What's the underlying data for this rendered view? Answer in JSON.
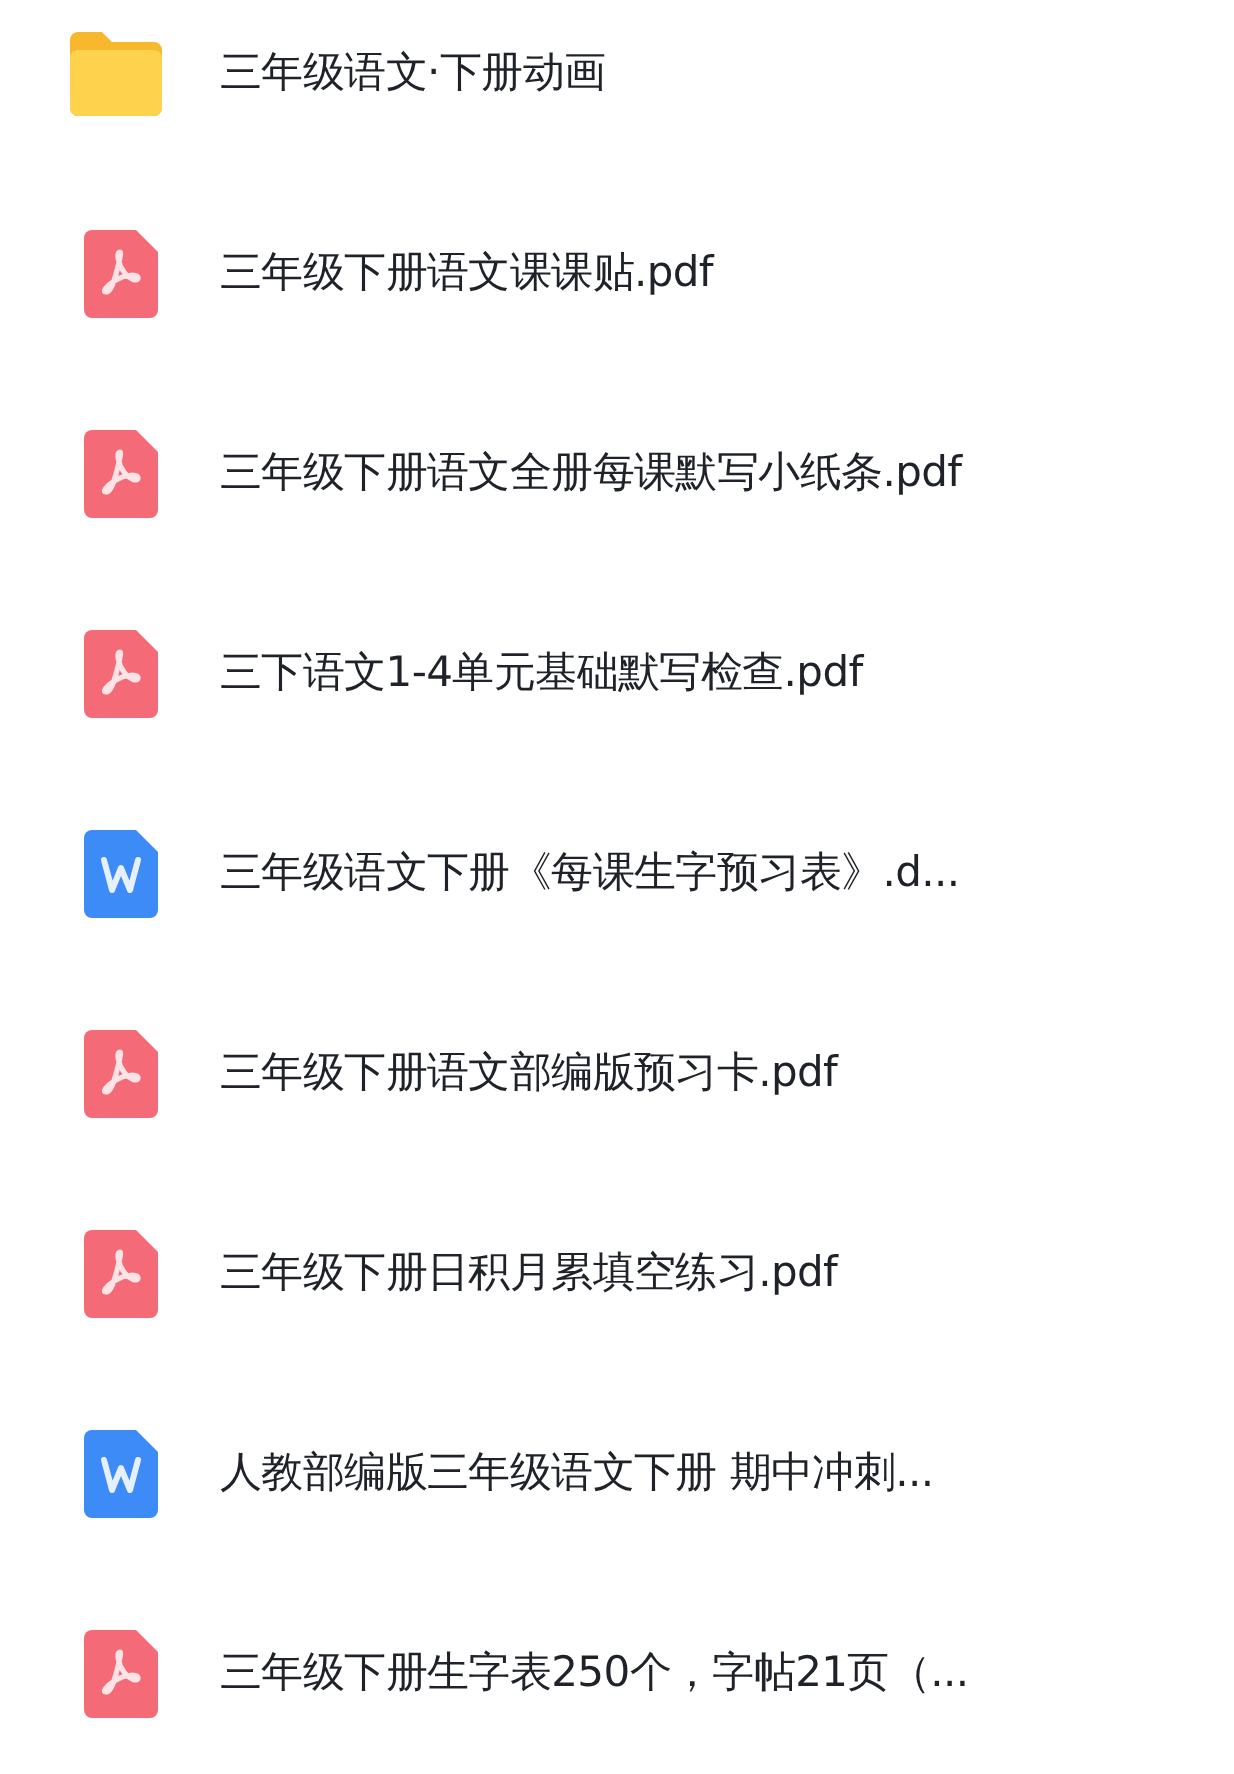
{
  "files": [
    {
      "kind": "folder",
      "name": "三年级语文·下册动画"
    },
    {
      "kind": "pdf",
      "name": "三年级下册语文课课贴.pdf"
    },
    {
      "kind": "pdf",
      "name": "三年级下册语文全册每课默写小纸条.pdf"
    },
    {
      "kind": "pdf",
      "name": "三下语文1-4单元基础默写检查.pdf"
    },
    {
      "kind": "word",
      "name": "三年级语文下册《每课生字预习表》.d..."
    },
    {
      "kind": "pdf",
      "name": "三年级下册语文部编版预习卡.pdf"
    },
    {
      "kind": "pdf",
      "name": "三年级下册日积月累填空练习.pdf"
    },
    {
      "kind": "word",
      "name": "人教部编版三年级语文下册 期中冲刺..."
    },
    {
      "kind": "pdf",
      "name": "三年级下册生字表250个，字帖21页（..."
    }
  ]
}
